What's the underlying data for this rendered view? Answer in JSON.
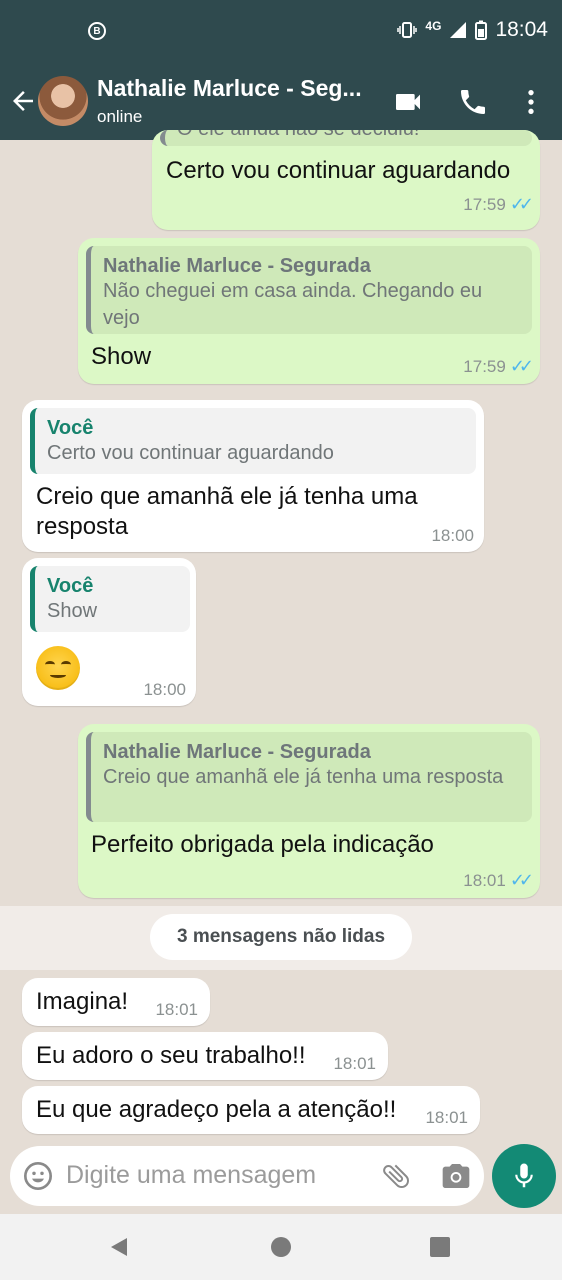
{
  "status_bar": {
    "indicator": "B",
    "network": "4G",
    "time": "18:04"
  },
  "header": {
    "contact_name": "Nathalie Marluce - Seg...",
    "status": "online"
  },
  "messages": [
    {
      "type": "outgoing",
      "text": "Certo vou continuar aguardando",
      "time": "17:59",
      "partial_quote_text": "O ele ainda não se decidiu!"
    },
    {
      "type": "outgoing",
      "quote_name": "Nathalie Marluce - Segurada",
      "quote_text": "Não cheguei em casa ainda. Chegando eu vejo",
      "text": "Show",
      "time": "17:59"
    },
    {
      "type": "incoming",
      "quote_name": "Você",
      "quote_text": "Certo vou continuar aguardando",
      "text": "Creio que amanhã ele já tenha uma resposta",
      "time": "18:00"
    },
    {
      "type": "incoming",
      "quote_name": "Você",
      "quote_text": "Show",
      "emoji": "smirking-face",
      "time": "18:00"
    },
    {
      "type": "outgoing",
      "quote_name": "Nathalie Marluce - Segurada",
      "quote_text": "Creio que amanhã ele já tenha uma resposta",
      "text": "Perfeito obrigada pela indicação",
      "time": "18:01"
    },
    {
      "type": "incoming",
      "text": "Imagina!",
      "time": "18:01"
    },
    {
      "type": "incoming",
      "text": "Eu adoro o seu trabalho!!",
      "time": "18:01"
    },
    {
      "type": "incoming",
      "text": "Eu que agradeço pela a atenção!!",
      "time": "18:01"
    }
  ],
  "unread_banner": "3 mensagens não lidas",
  "composer": {
    "placeholder": "Digite uma mensagem"
  },
  "colors": {
    "header": "#2f4a4e",
    "outgoing": "#dcf8c6",
    "incoming": "#ffffff",
    "accent": "#138a75",
    "read_ticks": "#4fb6ec"
  },
  "icons": [
    "back-arrow-icon",
    "video-call-icon",
    "phone-icon",
    "more-options-icon",
    "emoji-icon",
    "attach-icon",
    "camera-icon",
    "mic-icon"
  ]
}
